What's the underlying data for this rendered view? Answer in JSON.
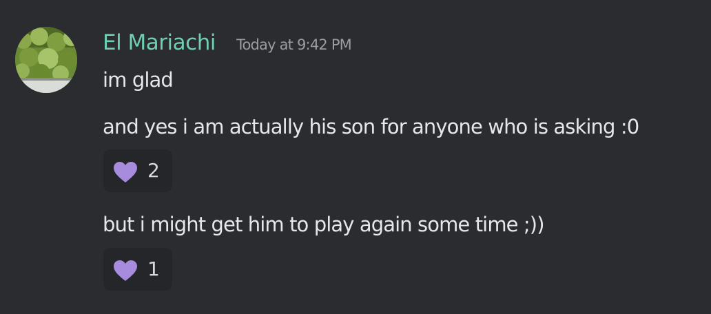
{
  "message": {
    "author": "El Mariachi",
    "timestamp": "Today at 9:42 PM",
    "avatar_icon": "user-avatar-plant-photo",
    "author_color": "#6fcfb2"
  },
  "lines": [
    {
      "text": "im glad"
    },
    {
      "text": "and yes i am actually his son for anyone who is asking :0"
    },
    {
      "text": "but i might get him to play again some time ;))"
    }
  ],
  "reactions": [
    {
      "emoji": "purple-heart-icon",
      "count": "2",
      "color": "#a78bdc"
    },
    {
      "emoji": "purple-heart-icon",
      "count": "1",
      "color": "#a78bdc"
    }
  ]
}
